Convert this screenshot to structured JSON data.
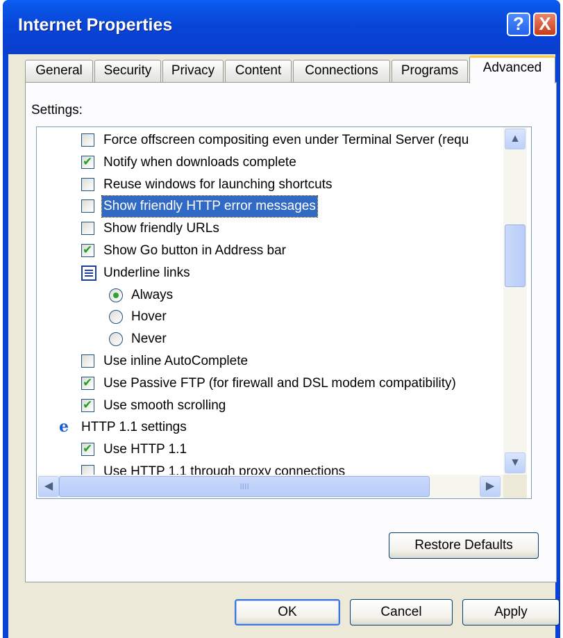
{
  "window": {
    "title": "Internet Properties",
    "help_glyph": "?",
    "close_glyph": "X"
  },
  "tabs": [
    {
      "label": "General"
    },
    {
      "label": "Security"
    },
    {
      "label": "Privacy"
    },
    {
      "label": "Content"
    },
    {
      "label": "Connections"
    },
    {
      "label": "Programs"
    },
    {
      "label": "Advanced"
    }
  ],
  "active_tab": "Advanced",
  "settings": {
    "label": "Settings:",
    "items": [
      {
        "label": "Force offscreen compositing even under Terminal Server (requ",
        "type": "checkbox",
        "checked": false
      },
      {
        "label": "Notify when downloads complete",
        "type": "checkbox",
        "checked": true
      },
      {
        "label": "Reuse windows for launching shortcuts",
        "type": "checkbox",
        "checked": false
      },
      {
        "label": "Show friendly HTTP error messages",
        "type": "checkbox",
        "checked": false,
        "selected": true
      },
      {
        "label": "Show friendly URLs",
        "type": "checkbox",
        "checked": false
      },
      {
        "label": "Show Go button in Address bar",
        "type": "checkbox",
        "checked": true
      },
      {
        "label": "Underline links",
        "type": "group",
        "icon": "list-icon"
      },
      {
        "label": "Always",
        "type": "radio",
        "checked": true
      },
      {
        "label": "Hover",
        "type": "radio",
        "checked": false
      },
      {
        "label": "Never",
        "type": "radio",
        "checked": false
      },
      {
        "label": "Use inline AutoComplete",
        "type": "checkbox",
        "checked": false
      },
      {
        "label": "Use Passive FTP (for firewall and DSL modem compatibility)",
        "type": "checkbox",
        "checked": true
      },
      {
        "label": "Use smooth scrolling",
        "type": "checkbox",
        "checked": true
      },
      {
        "label": "HTTP 1.1 settings",
        "type": "category",
        "icon": "ie-icon"
      },
      {
        "label": "Use HTTP 1.1",
        "type": "checkbox",
        "checked": true
      },
      {
        "label": "Use HTTP 1.1 through proxy connections",
        "type": "checkbox",
        "checked": false
      }
    ],
    "scroll": {
      "up": "▲",
      "down": "▼",
      "left": "◀",
      "right": "▶",
      "grip": "IIII"
    }
  },
  "buttons": {
    "restore_defaults": "Restore Defaults",
    "ok": "OK",
    "cancel": "Cancel",
    "apply": "Apply"
  },
  "colors": {
    "titlebar": "#0842d6",
    "selection": "#316ac5",
    "face": "#ece9d8",
    "active_tab_accent": "#ffc83c"
  }
}
